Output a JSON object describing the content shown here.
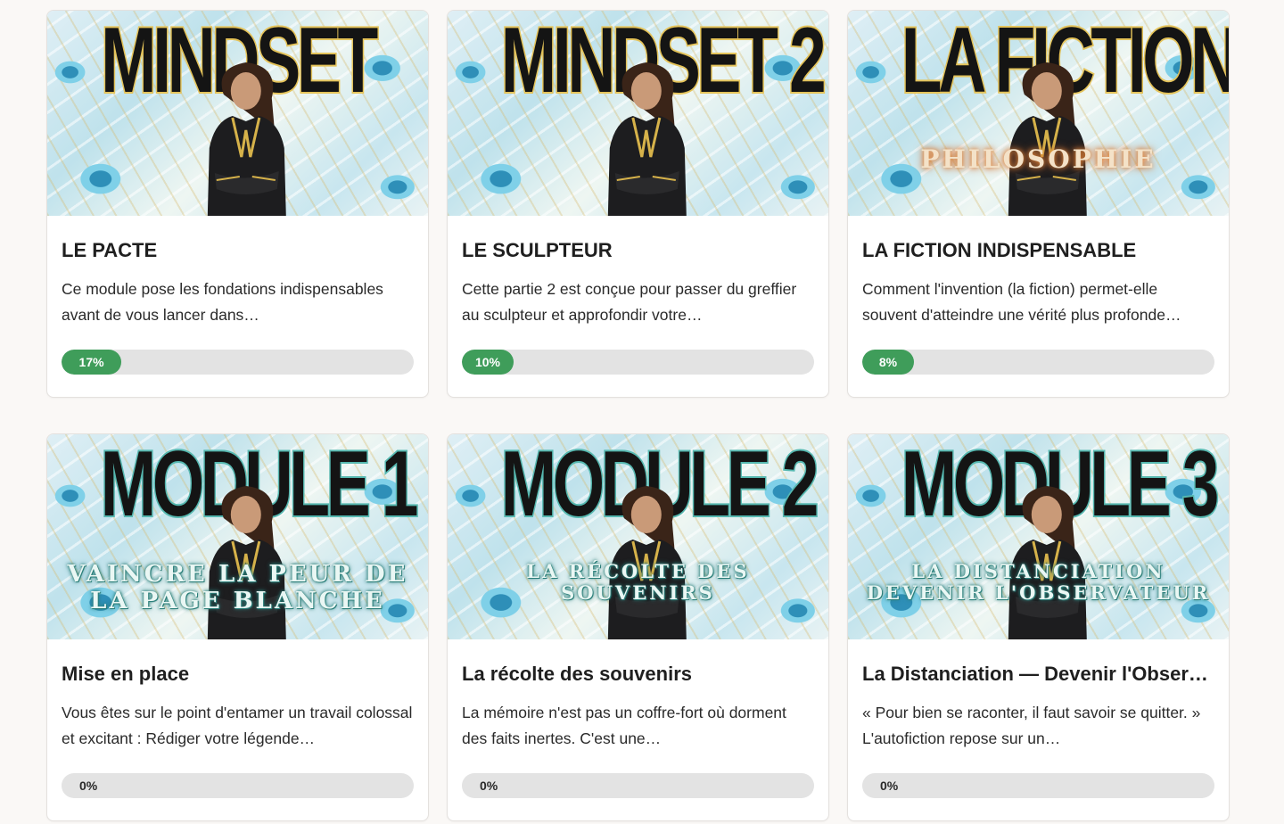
{
  "cards": [
    {
      "banner": {
        "title": "MINDSET",
        "subtitle": "",
        "style": "gold"
      },
      "title": "LE PACTE",
      "description": "Ce module pose les fondations indispensables avant de vous lancer dans…",
      "progress": 0.17,
      "progress_label": "17%"
    },
    {
      "banner": {
        "title": "MINDSET 2",
        "subtitle": "",
        "style": "gold"
      },
      "title": "LE SCULPTEUR",
      "description": "Cette partie 2 est conçue pour passer du greffier au sculpteur et approfondir votre…",
      "progress": 0.1,
      "progress_label": "10%"
    },
    {
      "banner": {
        "title": "LA FICTION",
        "subtitle": "PHILOSOPHIE",
        "style": "gold"
      },
      "title": "LA FICTION INDISPENSABLE",
      "description": "Comment l'invention (la fiction) permet-elle souvent d'atteindre une vérité plus profonde…",
      "progress": 0.08,
      "progress_label": "8%"
    },
    {
      "banner": {
        "title": "MODULE 1",
        "subtitle_lines": [
          "VAINCRE LA PEUR DE",
          "LA PAGE BLANCHE"
        ],
        "style": "teal"
      },
      "title": "Mise en place",
      "description": "Vous êtes sur le point d'entamer un travail colossal et excitant : Rédiger votre légende…",
      "progress": 0,
      "progress_label": "0%"
    },
    {
      "banner": {
        "title": "MODULE 2",
        "subtitle_lines": [
          "LA RÉCOLTE DES",
          "SOUVENIRS"
        ],
        "style": "teal"
      },
      "title": "La récolte des souvenirs",
      "description": "La mémoire n'est pas un coffre-fort où dorment des faits inertes. C'est une…",
      "progress": 0,
      "progress_label": "0%"
    },
    {
      "banner": {
        "title": "MODULE 3",
        "subtitle_lines": [
          "LA DISTANCIATION",
          "DEVENIR L'OBSERVATEUR"
        ],
        "style": "teal"
      },
      "title": "La Distanciation — Devenir l'Observateur",
      "description": "« Pour bien se raconter, il faut savoir se quitter. » L'autofiction repose sur un…",
      "progress": 0,
      "progress_label": "0%"
    }
  ],
  "colors": {
    "progress_fill": "#3f9d5a",
    "progress_track": "#e3e3e3",
    "banner_outline_gold": "#e4c35a",
    "banner_outline_teal": "#56b8b0"
  }
}
